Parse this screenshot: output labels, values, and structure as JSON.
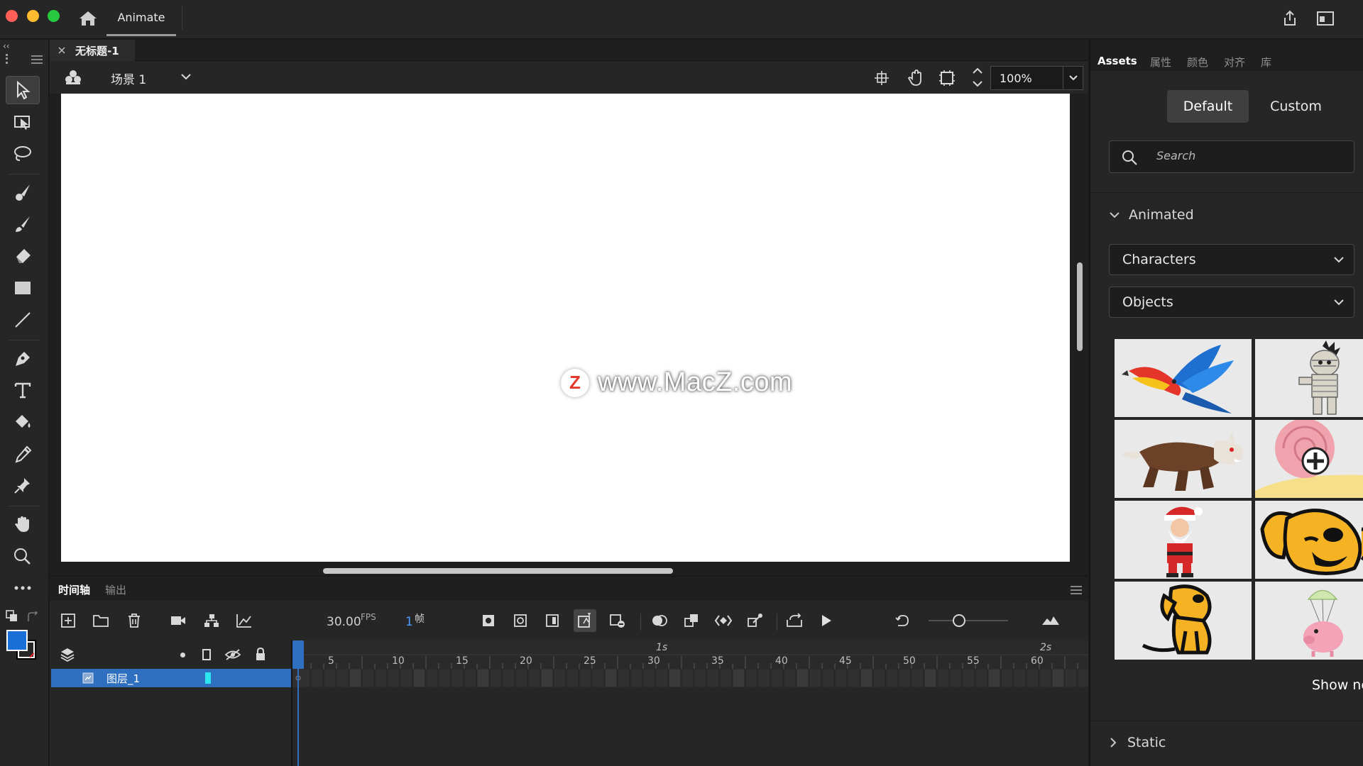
{
  "titlebar": {
    "app_tab": "Animate",
    "traffic_colors": [
      "#ff5f57",
      "#febc2e",
      "#28c840"
    ]
  },
  "toolbar": {
    "tools": [
      "selection-tool",
      "free-transform-tool",
      "lasso-tool",
      "paint-brush-tool",
      "brush-tool",
      "eraser-tool",
      "rectangle-tool",
      "line-tool",
      "pen-tool",
      "text-tool",
      "paint-bucket-tool",
      "eyedropper-tool",
      "pin-tool",
      "hand-tool",
      "zoom-tool",
      "more-tools"
    ],
    "stroke_color": "#000000",
    "fill_color": "#1a6fd6"
  },
  "document": {
    "tab_title": "无标题-1",
    "scene": "场景 1",
    "zoom": "100%",
    "watermark": "www.MacZ.com",
    "watermark_logo": "Z"
  },
  "timeline": {
    "tabs": [
      "时间轴",
      "输出"
    ],
    "fps_value": "30.00",
    "fps_unit": "FPS",
    "frame_value": "1",
    "frame_unit": "帧",
    "layer_name": "图层_1",
    "ruler_ticks": [
      "5",
      "10",
      "15",
      "20",
      "25",
      "30",
      "35",
      "40",
      "45",
      "50",
      "55",
      "60"
    ],
    "ruler_seconds": [
      "1s",
      "2s"
    ]
  },
  "right_panel": {
    "tabs": [
      "Assets",
      "属性",
      "颜色",
      "对齐",
      "库"
    ],
    "segments": {
      "default": "Default",
      "custom": "Custom"
    },
    "search_placeholder": "Search",
    "section_animated": "Animated",
    "dropdowns": [
      "Characters",
      "Objects"
    ],
    "thumbnails": [
      "parrot",
      "mummy",
      "werewolf",
      "snail",
      "santa",
      "dog-face",
      "dog-sitting",
      "parachute-pig"
    ],
    "show_new": "Show ne",
    "section_static": "Static"
  }
}
